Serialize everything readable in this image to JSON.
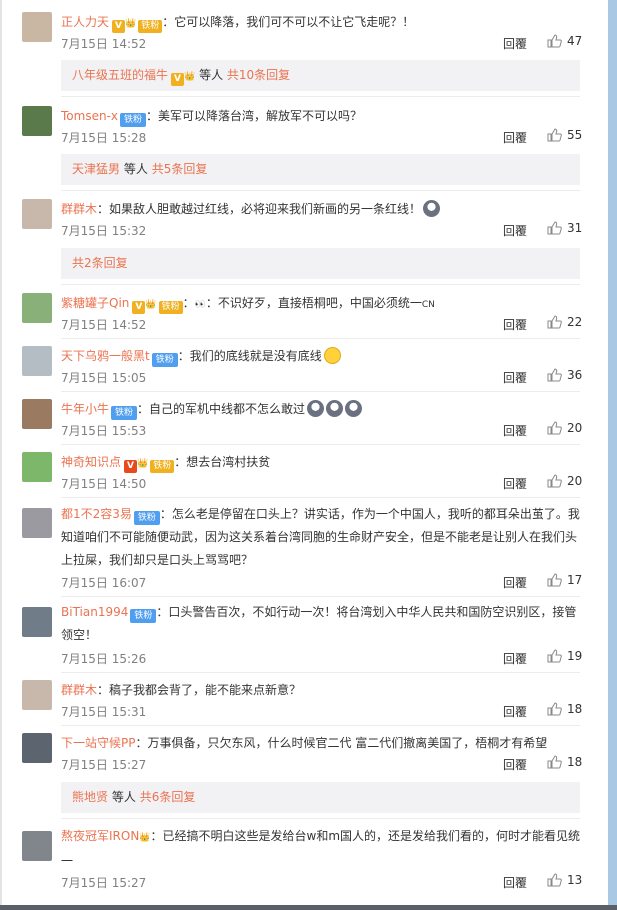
{
  "labels": {
    "reply": "回覆",
    "and": "等人"
  },
  "comments": [
    {
      "user": "正人力天",
      "badges": [
        "vip",
        "group"
      ],
      "text": "：它可以降落，我们可不可以不让它飞走呢？！",
      "time": "7月15日 14:52",
      "likes": "47",
      "avatar_color": "#c9b7a3"
    },
    {
      "user": "Tomsen-x",
      "badges": [
        "fan"
      ],
      "text": "：美军可以降落台湾，解放军不可以吗？",
      "time": "7月15日 15:28",
      "likes": "55",
      "avatar_color": "#5a7a4c"
    },
    {
      "user": "群群木",
      "badges": [],
      "text": "：如果敌人胆敢越过红线，必将迎来我们新画的另一条红线！",
      "time": "7月15日 15:32",
      "likes": "31",
      "avatar_color": "#c8b7ab"
    },
    {
      "user": "紫糖罐子Qin",
      "badges": [
        "vip",
        "group"
      ],
      "text": "：不识好歹，直接梧桐吧，中国必须统一",
      "time": "7月15日 14:52",
      "likes": "22",
      "avatar_color": "#8ab07a"
    },
    {
      "user": "天下乌鸦一般黑t",
      "badges": [
        "fan"
      ],
      "text": "：我们的底线就是没有底线",
      "time": "7月15日 15:05",
      "likes": "36",
      "avatar_color": "#b4bcc4"
    },
    {
      "user": "牛年小牛",
      "badges": [
        "fan"
      ],
      "text": "：自己的军机中线都不怎么敢过",
      "time": "7月15日 15:53",
      "likes": "20",
      "avatar_color": "#9a7a60"
    },
    {
      "user": "神奇知识点",
      "badges": [
        "vip-red",
        "group"
      ],
      "text": "：想去台湾村扶贫",
      "time": "7月15日 14:50",
      "likes": "20",
      "avatar_color": "#7db86a"
    },
    {
      "user": "都1不2容3易",
      "badges": [
        "fan"
      ],
      "text": "：怎么老是停留在口头上？讲实话，作为一个中国人，我听的都耳朵出茧了。我知道咱们不可能随便动武，因为这关系着台湾同胞的生命财产安全，但是不能老是让别人在我们头上拉屎，我们却只是口头上骂骂吧？",
      "time": "7月15日 16:07",
      "likes": "17",
      "avatar_color": "#9a9aa0"
    },
    {
      "user": "BiTian1994",
      "badges": [
        "fan"
      ],
      "text": "：口头警告百次，不如行动一次！将台湾划入中华人民共和国防空识别区，接管领空！",
      "time": "7月15日 15:26",
      "likes": "19",
      "avatar_color": "#707c88"
    },
    {
      "user": "群群木",
      "badges": [],
      "text": "：稿子我都会背了，能不能来点新意？",
      "time": "7月15日 15:31",
      "likes": "18",
      "avatar_color": "#c8b7ab"
    },
    {
      "user": "下一站守候PP",
      "badges": [],
      "text": "：万事俱备，只欠东风，什么时候官二代 富二代们撤离美国了，梧桐才有希望",
      "time": "7月15日 15:27",
      "likes": "18",
      "avatar_color": "#5c6470"
    },
    {
      "user": "熬夜冠军IRON",
      "badges": [
        "vip"
      ],
      "text": "：已经搞不明白这些是发给台w和m国人的，还是发给我们看的，何时才能看见统一",
      "time": "7月15日 15:27",
      "likes": "13",
      "avatar_color": "#80868c"
    }
  ],
  "reply_groups": [
    {
      "name": "八年级五班的福牛",
      "badges": [
        "vip",
        "group-plain"
      ],
      "count": "共10条回复"
    },
    {
      "name": "天津猛男",
      "badges": [],
      "count": "共5条回复"
    },
    {
      "name": "",
      "badges": [],
      "count": "共2条回复"
    },
    {
      "name": "熊地贤",
      "badges": [],
      "count": "共6条回复"
    }
  ],
  "badge_text": {
    "vip": "V",
    "fan": "铁粉",
    "group": "铁粉"
  },
  "emoji_suffix": {
    "cn": "CN"
  }
}
